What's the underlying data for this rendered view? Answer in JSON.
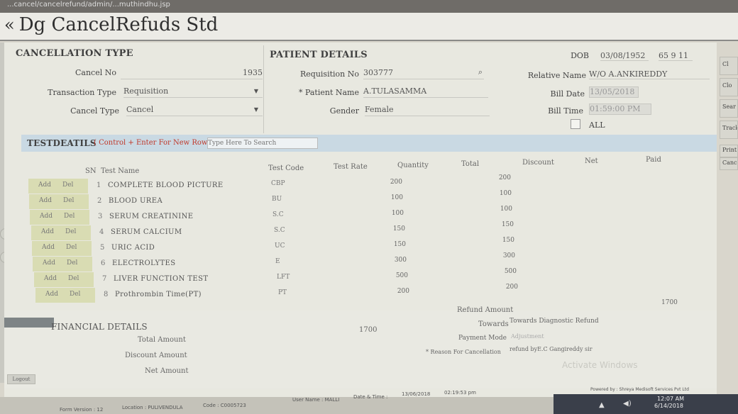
{
  "browser": {
    "url_text": "...cancel/cancelrefund/admin/...muthindhu.jsp"
  },
  "app": {
    "title": "Dg CancelRefuds Std"
  },
  "cancellation": {
    "heading": "CANCELLATION TYPE",
    "cancel_no_label": "Cancel No",
    "cancel_no_value": "1935",
    "transaction_type_label": "Transaction Type",
    "transaction_type_value": "Requisition",
    "cancel_type_label": "Cancel Type",
    "cancel_type_value": "Cancel"
  },
  "patient": {
    "heading": "PATIENT DETAILS",
    "requisition_no_label": "Requisition No",
    "requisition_no_value": "303777",
    "patient_name_label": "* Patient Name",
    "patient_name_value": "A.TULASAMMA",
    "gender_label": "Gender",
    "gender_value": "Female"
  },
  "info": {
    "dob_label": "DOB",
    "dob_value": "03/08/1952",
    "age_value": "65  9  11",
    "relative_name_label": "Relative Name",
    "relative_name_value": "W/O A.ANKIREDDY",
    "bill_date_label": "Bill Date",
    "bill_date_value": "13/05/2018",
    "bill_time_label": "Bill Time",
    "bill_time_value": "01:59:00 PM",
    "all_label": "ALL"
  },
  "side_buttons": [
    "Cl",
    "Clo",
    "Sear",
    "Tracki",
    "Print",
    "Cancel"
  ],
  "tests": {
    "heading": "TESTDEATILS",
    "hint": "( Control + Enter For New Row )",
    "search_placeholder": "Type Here To Search",
    "columns": {
      "sn": "SN",
      "test_name": "Test Name",
      "test_code": "Test Code",
      "test_rate": "Test Rate",
      "quantity": "Quantity",
      "total": "Total",
      "discount": "Discount",
      "net": "Net",
      "paid": "Paid"
    },
    "add_label": "Add",
    "del_label": "Del",
    "rows": [
      {
        "sn": "1",
        "name": "COMPLETE BLOOD PICTURE",
        "code": "CBP",
        "rate": "200",
        "total": "200"
      },
      {
        "sn": "2",
        "name": "BLOOD UREA",
        "code": "BU",
        "rate": "100",
        "total": "100"
      },
      {
        "sn": "3",
        "name": "SERUM CREATININE",
        "code": "S.C",
        "rate": "100",
        "total": "100"
      },
      {
        "sn": "4",
        "name": "SERUM CALCIUM",
        "code": "S.C",
        "rate": "150",
        "total": "150"
      },
      {
        "sn": "5",
        "name": "URIC ACID",
        "code": "UC",
        "rate": "150",
        "total": "150"
      },
      {
        "sn": "6",
        "name": "ELECTROLYTES",
        "code": "E",
        "rate": "300",
        "total": "300"
      },
      {
        "sn": "7",
        "name": "LIVER FUNCTION TEST",
        "code": "LFT",
        "rate": "500",
        "total": "500"
      },
      {
        "sn": "8",
        "name": "Prothrombin Time(PT)",
        "code": "PT",
        "rate": "200",
        "total": "200"
      }
    ],
    "grand_total": "1700"
  },
  "financial": {
    "heading": "FINANCIAL DETAILS",
    "total_amount_label": "Total Amount",
    "total_amount_value": "1700",
    "discount_amount_label": "Discount Amount",
    "net_amount_label": "Net Amount",
    "refund_amount_label": "Refund Amount",
    "towards_label": "Towards",
    "towards_value": "Towards Diagnostic Refund",
    "payment_mode_label": "Payment Mode",
    "payment_mode_value": "Adjustment",
    "reason_label": "* Reason For Cancellation",
    "reason_value": "refund byE.C Gangireddy sir"
  },
  "logout_label": "Logout",
  "watermark": "Activate Windows",
  "status": {
    "version": "Form Version : 12",
    "location": "Location : PULIVENDULA",
    "code": "Code : C0005723",
    "user_name": "User Name : MALLI",
    "date_time_label": "Date & Time :",
    "date": "13/06/2018",
    "time": "02:19:53 pm",
    "powered": "Powered by : Shreya Medisoft Services Pvt Ltd"
  },
  "taskbar": {
    "time": "12:07 AM",
    "date": "6/14/2018"
  }
}
